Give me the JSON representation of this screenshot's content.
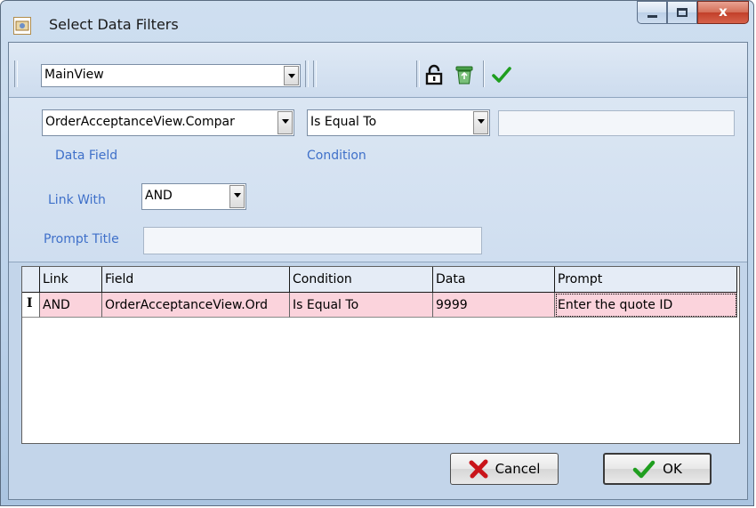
{
  "window": {
    "title": "Select Data Filters",
    "close_glyph": "x"
  },
  "toolbar": {
    "view_select": "MainView",
    "icons": [
      "lock-icon",
      "recycle-bin-icon",
      "checkmark-icon"
    ]
  },
  "editor": {
    "data_field_value": "OrderAcceptanceView.Compar",
    "condition_value": "Is Equal To",
    "data_value": "",
    "data_field_label": "Data Field",
    "condition_label": "Condition",
    "link_with_label": "Link With",
    "link_with_value": "AND",
    "prompt_title_label": "Prompt Title",
    "prompt_title_value": ""
  },
  "grid": {
    "columns": [
      "Link",
      "Field",
      "Condition",
      "Data",
      "Prompt"
    ],
    "rows": [
      {
        "indicator": "I",
        "link": "AND",
        "field": "OrderAcceptanceView.Ord",
        "condition": "Is Equal To",
        "data": "9999",
        "prompt": "Enter the quote ID"
      }
    ]
  },
  "buttons": {
    "cancel": "Cancel",
    "ok": "OK"
  },
  "colors": {
    "row_highlight": "#fbd3dc",
    "label_blue": "#3f70c9",
    "check_green": "#1f9e1f",
    "cancel_red": "#c9141a"
  }
}
